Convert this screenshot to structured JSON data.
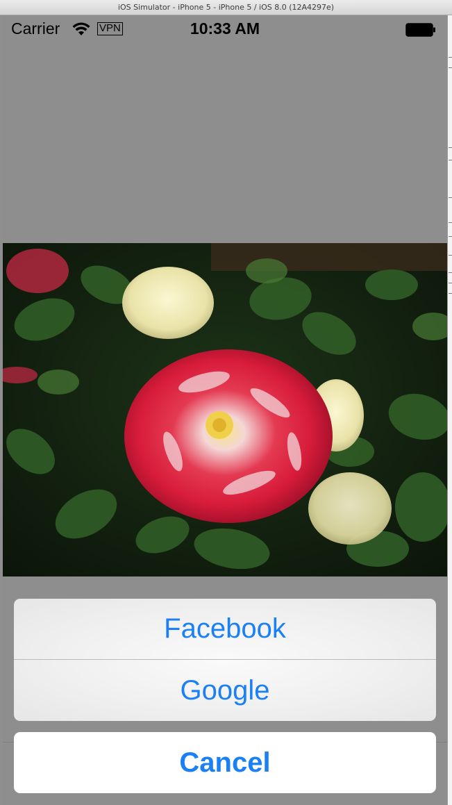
{
  "window": {
    "title": "iOS Simulator - iPhone 5 - iPhone 5 / iOS 8.0 (12A4297e)"
  },
  "status_bar": {
    "carrier": "Carrier",
    "vpn": "VPN",
    "time": "10:33 AM",
    "icons": [
      "wifi-icon",
      "battery-icon"
    ]
  },
  "photo": {
    "subject": "image"
  },
  "action_sheet": {
    "options": [
      {
        "label": "Facebook"
      },
      {
        "label": "Google"
      }
    ],
    "cancel_label": "Cancel",
    "accent_color": "#1b7ff5"
  }
}
